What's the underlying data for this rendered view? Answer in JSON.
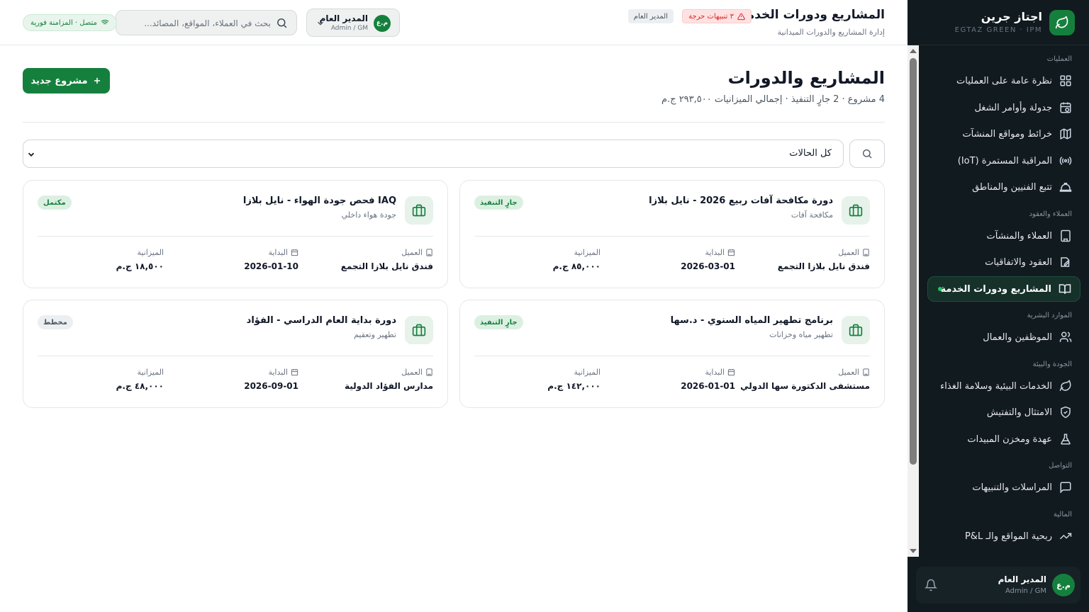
{
  "sidebar": {
    "brand_name": "اجتاز جرين",
    "brand_sub": "EGTAZ GREEN · IPM",
    "sections": {
      "operations": "العمليات",
      "clients_contracts": "العملاء والعقود",
      "hr": "الموارد البشرية",
      "quality_env": "الجودة والبيئة",
      "communication": "التواصل",
      "finance": "المالية"
    },
    "items": [
      {
        "label": "نظرة عامة على العمليات",
        "icon": "grid-icon"
      },
      {
        "label": "جدولة وأوامر الشغل",
        "icon": "calendar-clock-icon"
      },
      {
        "label": "خرائط ومواقع المنشآت",
        "icon": "map-icon"
      },
      {
        "label": "المراقبة المستمرة (IoT)",
        "icon": "radio-icon"
      },
      {
        "label": "تتبع الفنيين والمناطق",
        "icon": "hard-hat-icon"
      },
      {
        "label": "العملاء والمنشآت",
        "icon": "building-icon"
      },
      {
        "label": "العقود والاتفاقيات",
        "icon": "edit-document-icon"
      },
      {
        "label": "المشاريع ودورات الخدمة",
        "icon": "book-open-icon"
      },
      {
        "label": "الموظفين والعمال",
        "icon": "users-icon"
      },
      {
        "label": "الخدمات البيئية وسلامة الغذاء",
        "icon": "leaf-icon"
      },
      {
        "label": "الامتثال والتفتيش",
        "icon": "shield-check-icon"
      },
      {
        "label": "عهدة ومخزن المبيدات",
        "icon": "flask-icon"
      },
      {
        "label": "المراسلات والتنبيهات",
        "icon": "message-icon"
      },
      {
        "label": "ربحية المواقع والـ P&L",
        "icon": "trending-up-icon"
      }
    ],
    "user": {
      "initials": "م.ع",
      "name": "المدير العام",
      "role": "Admin / GM"
    }
  },
  "header": {
    "title": "المشاريع ودورات الخدمة",
    "subtitle": "إدارة المشاريع والدورات الميدانية",
    "alert_badge": "٣ تنبيهات حرجة",
    "role_badge": "المدير العام",
    "user": {
      "initials": "م.ع",
      "name": "المدير العام",
      "role": "Admin / GM"
    },
    "search_placeholder": "بحث في العملاء، المواقع، المصائد...",
    "connection": "متصل · المزامنة فورية"
  },
  "main": {
    "title": "المشاريع والدورات",
    "summary": "4 مشروع · 2 جارٍ التنفيذ · إجمالي الميزانيات ٢٩٣,٥٠٠ ج.م",
    "new_button": "مشروع جديد",
    "status_filter": "كل الحالات",
    "labels": {
      "client": "العميل",
      "start": "البداية",
      "budget": "الميزانية"
    }
  },
  "projects": [
    {
      "title": "دورة مكافحة آفات ربيع 2026 - نايل بلازا",
      "category": "مكافحة آفات",
      "status": "جارٍ التنفيذ",
      "status_color": "#15803d",
      "client": "فندق نايل بلازا التجمع",
      "start": "2026-03-01",
      "budget": "٨٥,٠٠٠ ج.م"
    },
    {
      "title": "IAQ فحص جودة الهواء - نايل بلازا",
      "category": "جودة هواء داخلي",
      "status": "مكتمل",
      "status_color": "#15803d",
      "client": "فندق نايل بلازا التجمع",
      "start": "2026-01-10",
      "budget": "١٨,٥٠٠ ج.م"
    },
    {
      "title": "برنامج تطهير المياه السنوي - د.سها",
      "category": "تطهير مياه وخزانات",
      "status": "جارٍ التنفيذ",
      "status_color": "#15803d",
      "client": "مستشفى الدكتورة سها الدولي",
      "start": "2026-01-01",
      "budget": "١٤٢,٠٠٠ ج.م"
    },
    {
      "title": "دورة بداية العام الدراسي - الفؤاد",
      "category": "تطهير وتعقيم",
      "status": "مخطط",
      "status_color": "#4b5563",
      "client": "مدارس الفؤاد الدولية",
      "start": "2026-09-01",
      "budget": "٤٨,٠٠٠ ج.م"
    }
  ],
  "colors": {
    "accent": "#15803d",
    "sidebar_bg": "#111a1f",
    "alert": "#dc2626"
  }
}
